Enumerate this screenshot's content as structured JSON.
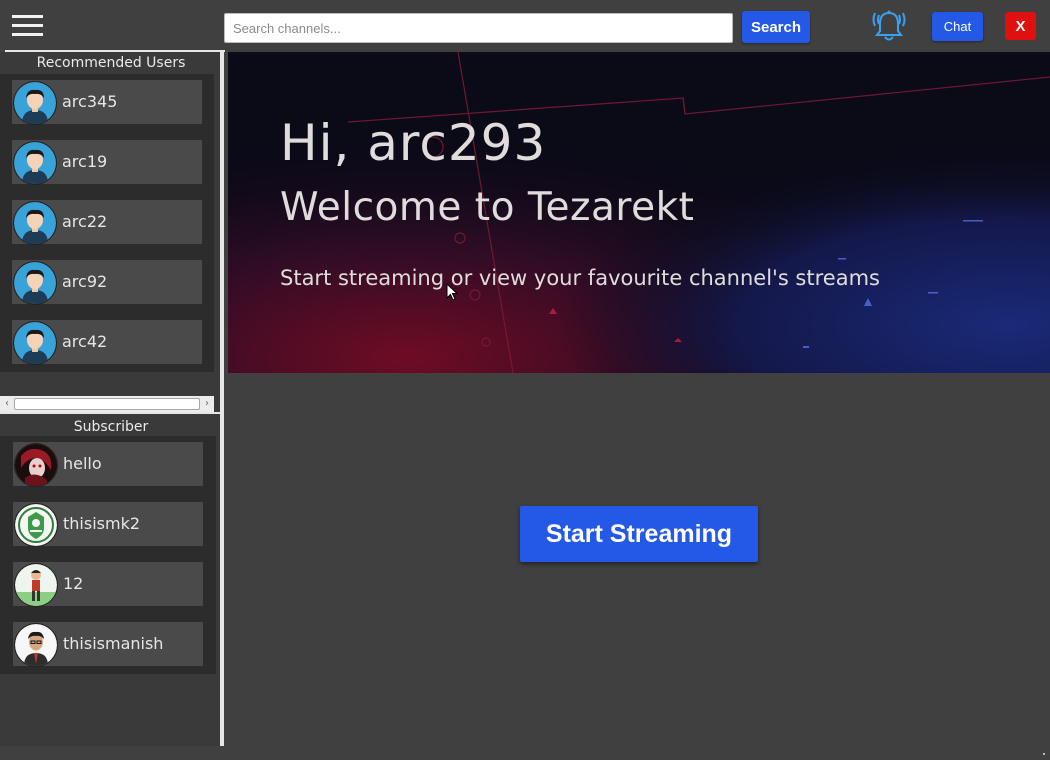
{
  "header": {
    "search_placeholder": "Search channels...",
    "search_label": "Search",
    "chat_label": "Chat",
    "close_label": "X"
  },
  "sidebar": {
    "recommended_title": "Recommended Users",
    "recommended": [
      {
        "name": "arc345"
      },
      {
        "name": "arc19"
      },
      {
        "name": "arc22"
      },
      {
        "name": "arc92"
      },
      {
        "name": "arc42"
      }
    ],
    "subscriber_title": "Subscriber",
    "subscribers": [
      {
        "name": "hello"
      },
      {
        "name": "thisismk2"
      },
      {
        "name": "12"
      },
      {
        "name": "thisismanish"
      }
    ]
  },
  "hero": {
    "greeting": "Hi, arc293",
    "welcome": "Welcome to Tezarekt",
    "tagline": "Start streaming or view your favourite channel's streams"
  },
  "main": {
    "start_label": "Start Streaming"
  },
  "colors": {
    "background": "#404040",
    "accent_blue": "#2458e6",
    "close_red": "#e01010",
    "bell_blue": "#3aa0f0"
  }
}
